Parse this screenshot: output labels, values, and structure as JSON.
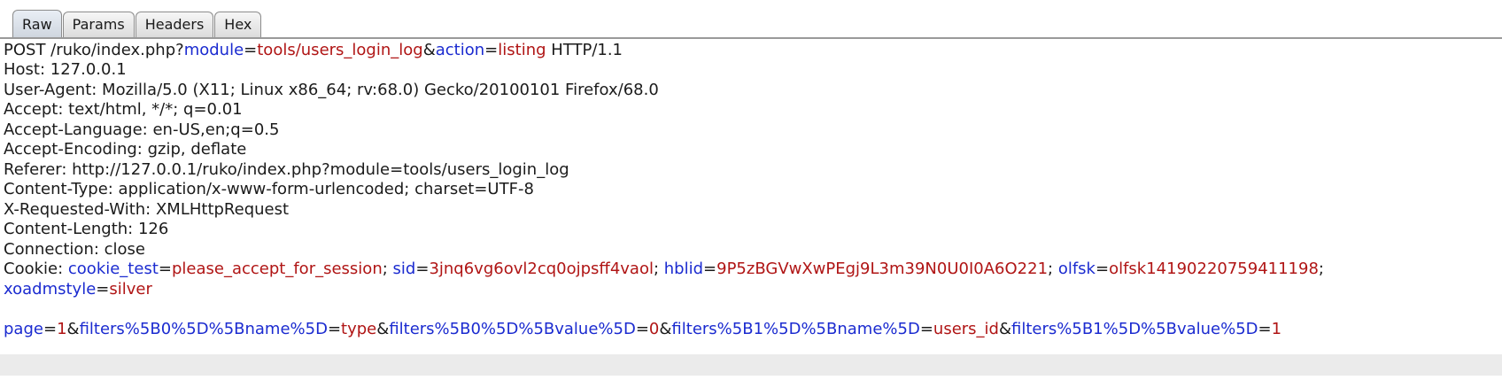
{
  "tabs": [
    {
      "label": "Raw",
      "active": true
    },
    {
      "label": "Params",
      "active": false
    },
    {
      "label": "Headers",
      "active": false
    },
    {
      "label": "Hex",
      "active": false
    }
  ],
  "request": {
    "method": "POST",
    "path": " /ruko/index.php?",
    "q1_key": "module",
    "q1_value": "tools/users_login_log",
    "q2_key": "action",
    "q2_value": "listing",
    "version": " HTTP/1.1"
  },
  "headers": [
    "Host: 127.0.0.1",
    "User-Agent: Mozilla/5.0 (X11; Linux x86_64; rv:68.0) Gecko/20100101 Firefox/68.0",
    "Accept: text/html, */*; q=0.01",
    "Accept-Language: en-US,en;q=0.5",
    "Accept-Encoding: gzip, deflate",
    "Referer: http://127.0.0.1/ruko/index.php?module=tools/users_login_log",
    "Content-Type: application/x-www-form-urlencoded; charset=UTF-8",
    "X-Requested-With: XMLHttpRequest",
    "Content-Length: 126",
    "Connection: close"
  ],
  "cookie": {
    "prefix": "Cookie: ",
    "pairs": [
      {
        "key": "cookie_test",
        "value": "please_accept_for_session"
      },
      {
        "key": "sid",
        "value": "3jnq6vg6ovl2cq0ojpsff4vaol"
      },
      {
        "key": "hblid",
        "value": "9P5zBGVwXwPEgj9L3m39N0U0I0A6O221"
      },
      {
        "key": "olfsk",
        "value": "olfsk14190220759411198"
      },
      {
        "key": "xoadmstyle",
        "value": "silver"
      }
    ]
  },
  "body_params": [
    {
      "key": "page",
      "value": "1"
    },
    {
      "key": "filters%5B0%5D%5Bname%5D",
      "value": "type"
    },
    {
      "key": "filters%5B0%5D%5Bvalue%5D",
      "value": "0"
    },
    {
      "key": "filters%5B1%5D%5Bname%5D",
      "value": "users_id"
    },
    {
      "key": "filters%5B1%5D%5Bvalue%5D",
      "value": "1"
    }
  ],
  "colors": {
    "param_key": "#1b2bd0",
    "param_value": "#b01515",
    "text": "#1b1b1b",
    "body_highlight": "#ebebeb"
  }
}
